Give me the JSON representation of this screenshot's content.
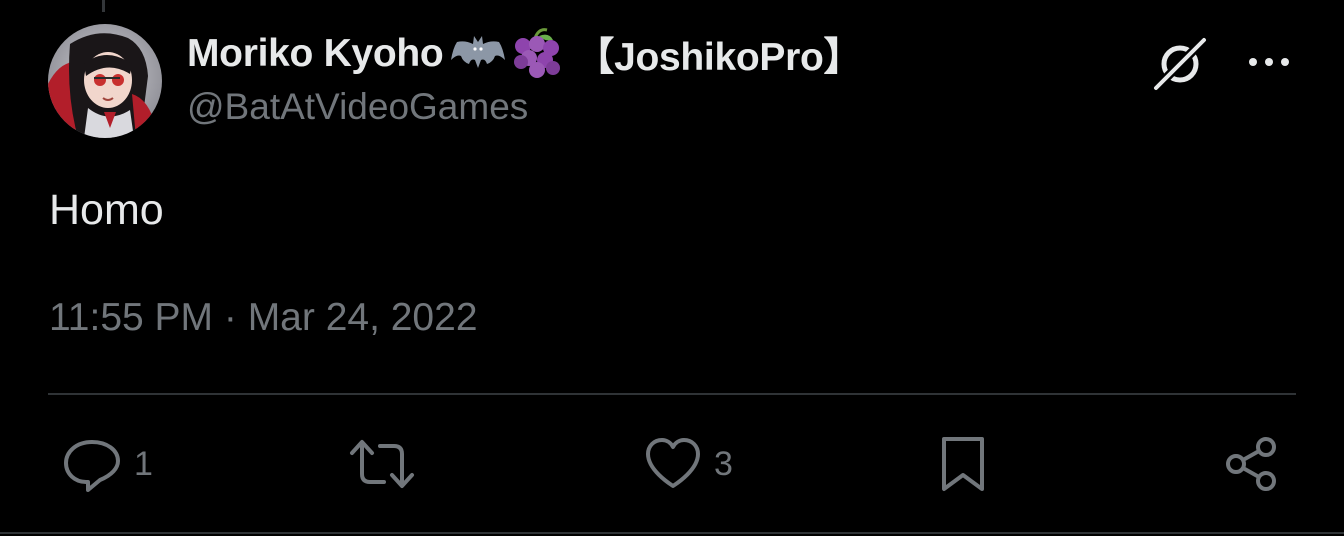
{
  "tweet": {
    "author": {
      "display_name": "Moriko Kyoho",
      "name_emojis": [
        "bat-emoji",
        "grapes-emoji"
      ],
      "affiliation": "【JoshikoPro】",
      "handle": "@BatAtVideoGames",
      "avatar": "avatar-image"
    },
    "text": "Homo",
    "timestamp": "11:55 PM · Mar 24, 2022",
    "header_icons": [
      "grok-icon",
      "more-icon"
    ],
    "actions": {
      "reply": {
        "icon": "reply-icon",
        "count": "1"
      },
      "retweet": {
        "icon": "retweet-icon",
        "count": ""
      },
      "like": {
        "icon": "heart-icon",
        "count": "3"
      },
      "bookmark": {
        "icon": "bookmark-icon"
      },
      "share": {
        "icon": "share-icon"
      }
    }
  },
  "colors": {
    "background": "#000000",
    "primary_text": "#e7e9ea",
    "secondary_text": "#71767b",
    "divider": "#2f3336"
  }
}
